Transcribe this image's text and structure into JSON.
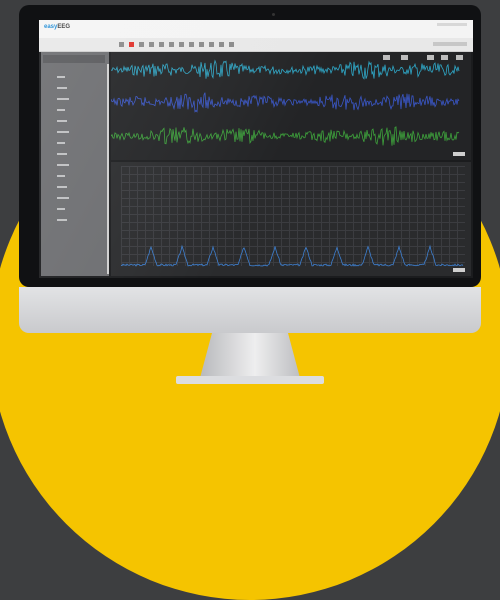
{
  "app": {
    "logo_part1": "easy",
    "logo_part2": "EEG"
  },
  "colors": {
    "background": "#3d3e40",
    "accent_circle": "#f5c400",
    "wave_top": "#2fa8c8",
    "wave_middle": "#3a57c8",
    "wave_bottom": "#3ea33c",
    "spectrum": "#3d7fd0"
  },
  "toolbar": {
    "icons": [
      "file-icon",
      "record-icon",
      "play-icon",
      "stop-icon",
      "save-icon",
      "settings-icon",
      "view-icon",
      "zoom-icon",
      "filter-icon",
      "marker-icon",
      "export-icon",
      "help-icon"
    ]
  },
  "sidebar": {
    "title": "",
    "item_count": 14
  },
  "panels": {
    "waveform_channels": 3,
    "spectrum_peaks": 10
  }
}
